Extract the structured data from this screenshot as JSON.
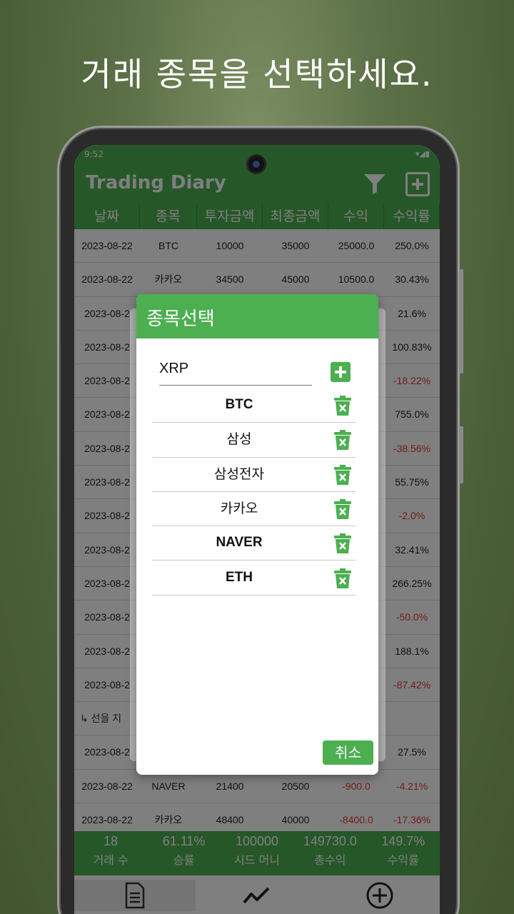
{
  "headline": "거래 종목을 선택하세요.",
  "status": {
    "time": "9:52",
    "icons": "▾◢▮"
  },
  "app": {
    "title": "Trading Diary"
  },
  "table": {
    "headers": [
      "날짜",
      "종목",
      "투자금액",
      "최종금액",
      "수익",
      "수익률"
    ],
    "rows": [
      [
        "2023-08-22",
        "BTC",
        "10000",
        "35000",
        "25000.0",
        "250.0%"
      ],
      [
        "2023-08-22",
        "카카오",
        "34500",
        "45000",
        "10500.0",
        "30.43%"
      ],
      [
        "2023-08-2",
        "",
        "",
        "",
        "",
        "21.6%"
      ],
      [
        "2023-08-2",
        "",
        "",
        "",
        "",
        "100.83%"
      ],
      [
        "2023-08-2",
        "",
        "",
        "",
        "",
        "-18.22%"
      ],
      [
        "2023-08-2",
        "",
        "",
        "",
        "",
        "755.0%"
      ],
      [
        "2023-08-2",
        "",
        "",
        "",
        "",
        "-38.56%"
      ],
      [
        "2023-08-2",
        "",
        "",
        "",
        "",
        "55.75%"
      ],
      [
        "2023-08-2",
        "",
        "",
        "",
        "",
        "-2.0%"
      ],
      [
        "2023-08-2",
        "",
        "",
        "",
        "",
        "32.41%"
      ],
      [
        "2023-08-2",
        "",
        "",
        "",
        "",
        "266.25%"
      ],
      [
        "2023-08-2",
        "",
        "",
        "",
        "",
        "-50.0%"
      ],
      [
        "2023-08-2",
        "",
        "",
        "",
        "",
        "188.1%"
      ],
      [
        "2023-08-2",
        "",
        "",
        "",
        "",
        "-87.42%"
      ]
    ],
    "note": "↳ 선을 지",
    "rows_after": [
      [
        "2023-08-2",
        "",
        "",
        "",
        "",
        "27.5%"
      ],
      [
        "2023-08-22",
        "NAVER",
        "21400",
        "20500",
        "-900.0",
        "-4.21%"
      ],
      [
        "2023-08-22",
        "카카오",
        "48400",
        "40000",
        "-8400.0",
        "-17.36%"
      ]
    ]
  },
  "footer": [
    {
      "value": "18",
      "label": "거래 수"
    },
    {
      "value": "61.11%",
      "label": "승률"
    },
    {
      "value": "100000",
      "label": "시드 머니"
    },
    {
      "value": "149730.0",
      "label": "총수익"
    },
    {
      "value": "149.7%",
      "label": "수익률"
    }
  ],
  "dialog": {
    "title": "종목선택",
    "input_value": "XRP",
    "items": [
      "BTC",
      "삼성",
      "삼성전자",
      "카카오",
      "NAVER",
      "ETH"
    ],
    "cancel_label": "취소"
  },
  "colors": {
    "accent": "#4caf50",
    "negative": "#e53935"
  }
}
